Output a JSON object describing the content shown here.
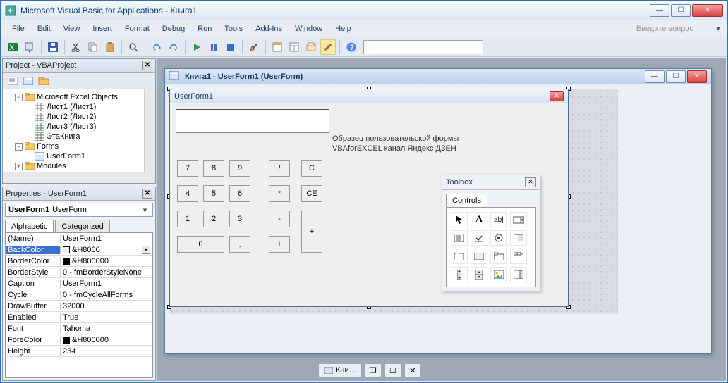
{
  "window": {
    "title": "Microsoft Visual Basic for Applications - Книга1"
  },
  "menu": [
    "File",
    "Edit",
    "View",
    "Insert",
    "Format",
    "Debug",
    "Run",
    "Tools",
    "Add-Ins",
    "Window",
    "Help"
  ],
  "menu_hotkeys": [
    "F",
    "E",
    "V",
    "I",
    "o",
    "D",
    "R",
    "T",
    "A",
    "W",
    "H"
  ],
  "help_placeholder": "Введите вопрос",
  "project": {
    "panel_title": "Project - VBAProject",
    "nodes": {
      "excel_objects": "Microsoft Excel Objects",
      "sheet1": "Лист1 (Лист1)",
      "sheet2": "Лист2 (Лист2)",
      "sheet3": "Лист3 (Лист3)",
      "workbook": "ЭтаКнига",
      "forms": "Forms",
      "userform1": "UserForm1",
      "modules": "Modules"
    }
  },
  "properties": {
    "panel_title": "Properties - UserForm1",
    "object_name": "UserForm1",
    "object_type": "UserForm",
    "tabs": {
      "alphabetic": "Alphabetic",
      "categorized": "Categorized"
    },
    "rows": [
      {
        "n": "(Name)",
        "v": "UserForm1"
      },
      {
        "n": "BackColor",
        "v": "&H8000",
        "swatch": "#efefef",
        "sel": true,
        "dd": true
      },
      {
        "n": "BorderColor",
        "v": "&H800000",
        "swatch": "#000"
      },
      {
        "n": "BorderStyle",
        "v": "0 - fmBorderStyleNone"
      },
      {
        "n": "Caption",
        "v": "UserForm1"
      },
      {
        "n": "Cycle",
        "v": "0 - fmCycleAllForms"
      },
      {
        "n": "DrawBuffer",
        "v": "32000"
      },
      {
        "n": "Enabled",
        "v": "True"
      },
      {
        "n": "Font",
        "v": "Tahoma"
      },
      {
        "n": "ForeColor",
        "v": "&H800000",
        "swatch": "#000"
      },
      {
        "n": "Height",
        "v": "234"
      }
    ]
  },
  "mdi": {
    "child_title": "Книга1 - UserForm1 (UserForm)",
    "form_caption": "UserForm1",
    "label1": "Образец пользовательской формы",
    "label2": "VBAforEXCEL канал Яндекс ДЗЕН",
    "buttons": {
      "b7": "7",
      "b8": "8",
      "b9": "9",
      "bdiv": "/",
      "bc": "C",
      "b4": "4",
      "b5": "5",
      "b6": "6",
      "bmul": "*",
      "bce": "CE",
      "b1": "1",
      "b2": "2",
      "b3": "3",
      "bmin": "-",
      "bplus": "+",
      "b0": "0",
      "bcom": ","
    }
  },
  "toolbox": {
    "title": "Toolbox",
    "tab": "Controls"
  },
  "taskbar": {
    "item": "Кни..."
  }
}
